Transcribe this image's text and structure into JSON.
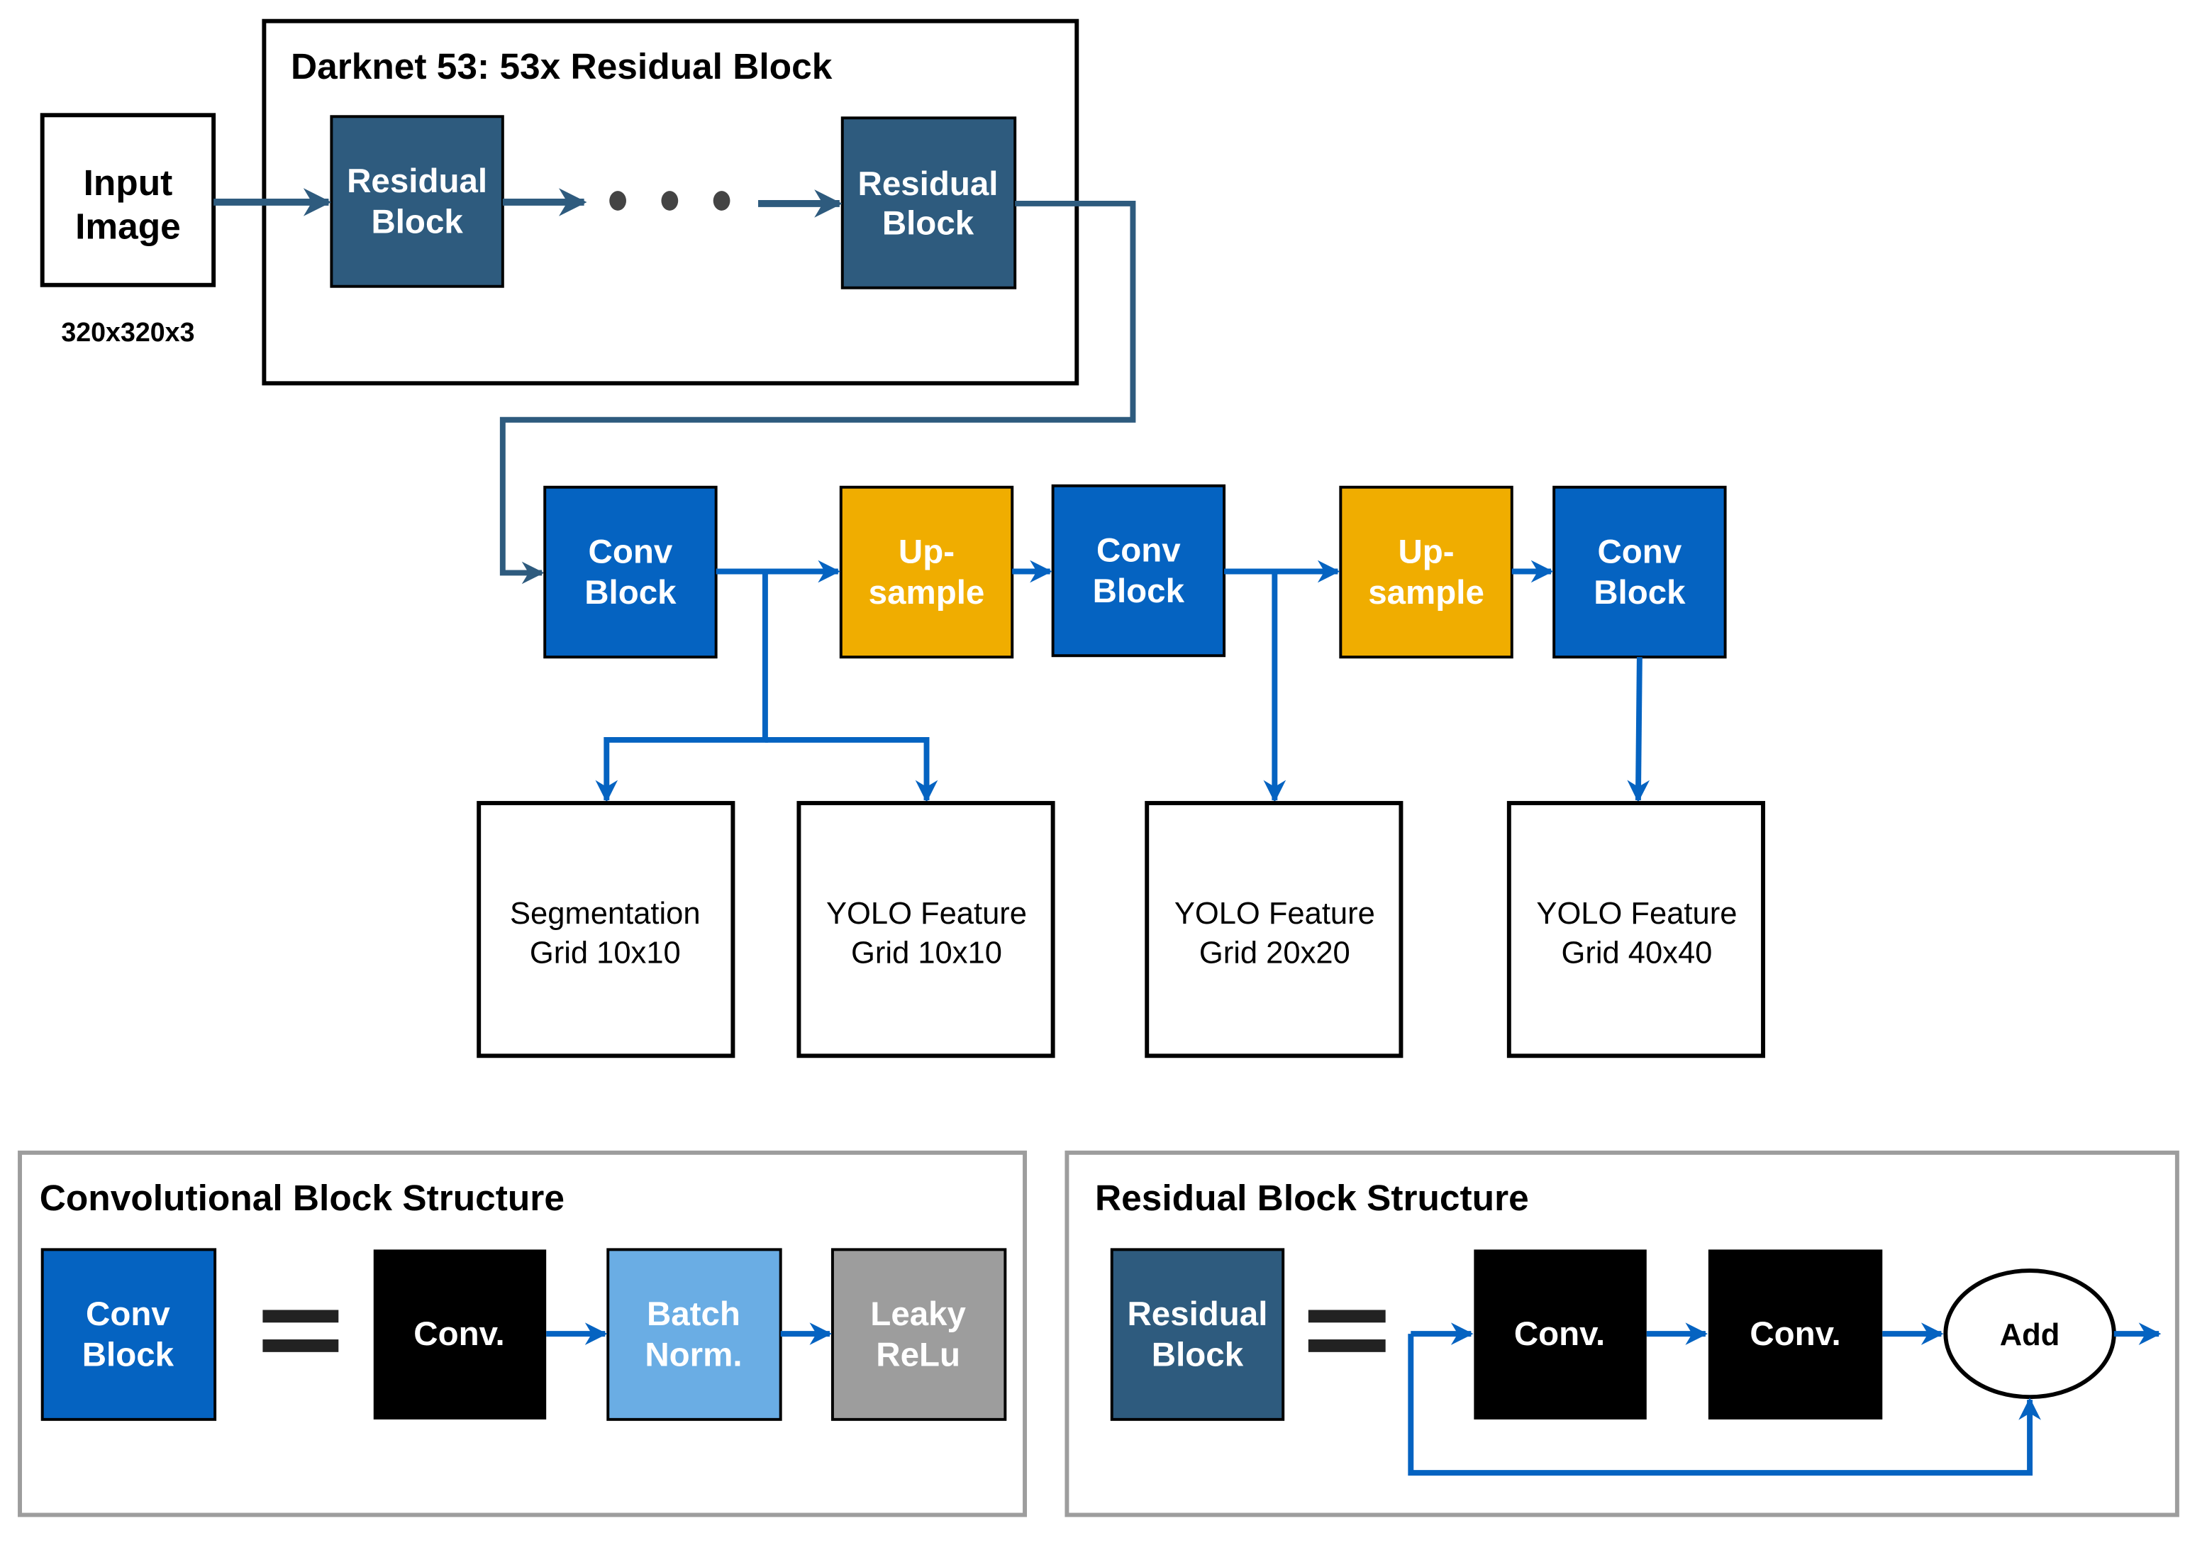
{
  "colors": {
    "residual_block": "#2e5b7e",
    "conv_block": "#0563c1",
    "upsample": "#f0ad00",
    "batch_norm": "#6aade4",
    "leaky_relu": "#9d9d9d",
    "conv_op": "#000000",
    "panel_border": "#9d9d9d"
  },
  "input": {
    "line1": "Input",
    "line2": "Image",
    "size": "320x320x3"
  },
  "darknet": {
    "title": "Darknet 53: 53x Residual Block",
    "block1": {
      "line1": "Residual",
      "line2": "Block"
    },
    "block2": {
      "line1": "Residual",
      "line2": "Block"
    }
  },
  "head": {
    "conv1": {
      "line1": "Conv",
      "line2": "Block"
    },
    "up1": {
      "line1": "Up-",
      "line2": "sample"
    },
    "conv2": {
      "line1": "Conv",
      "line2": "Block"
    },
    "up2": {
      "line1": "Up-",
      "line2": "sample"
    },
    "conv3": {
      "line1": "Conv",
      "line2": "Block"
    }
  },
  "outputs": [
    {
      "line1": "Segmentation",
      "line2": "Grid 10x10"
    },
    {
      "line1": "YOLO Feature",
      "line2": "Grid 10x10"
    },
    {
      "line1": "YOLO Feature",
      "line2": "Grid 20x20"
    },
    {
      "line1": "YOLO Feature",
      "line2": "Grid 40x40"
    }
  ],
  "conv_structure": {
    "title": "Convolutional Block Structure",
    "block": {
      "line1": "Conv",
      "line2": "Block"
    },
    "conv": "Conv.",
    "batch": {
      "line1": "Batch",
      "line2": "Norm."
    },
    "leaky": {
      "line1": "Leaky",
      "line2": "ReLu"
    }
  },
  "residual_structure": {
    "title": "Residual Block Structure",
    "block": {
      "line1": "Residual",
      "line2": "Block"
    },
    "conv1": "Conv.",
    "conv2": "Conv.",
    "add": "Add"
  }
}
